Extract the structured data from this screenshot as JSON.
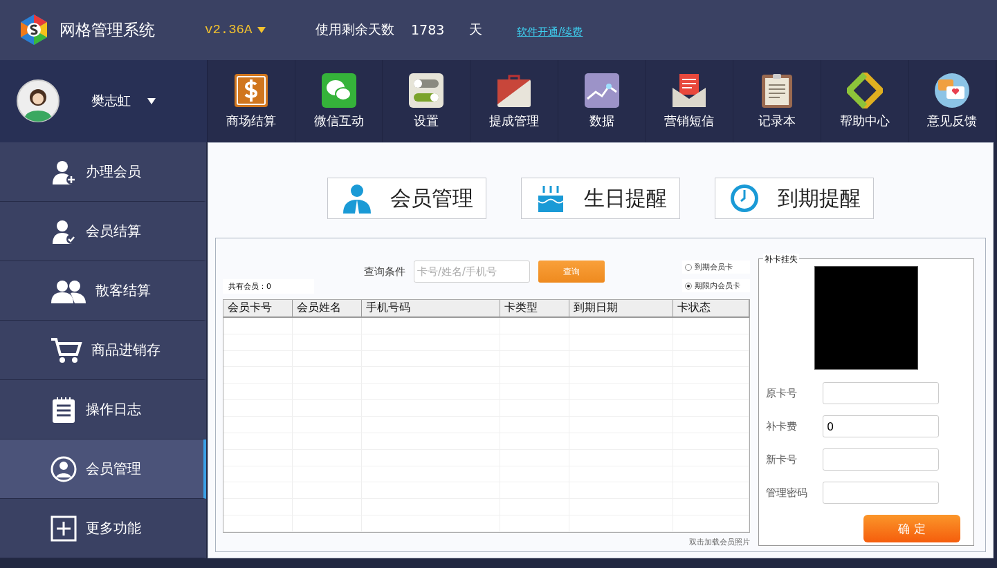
{
  "header": {
    "app_title": "网格管理系统",
    "version": "v2.36A",
    "days_label": "使用剩余天数",
    "days_value": "1783",
    "days_unit": "天",
    "renew_link": "软件开通/续费"
  },
  "user": {
    "name": "樊志虹"
  },
  "toolbar": [
    {
      "label": "商场结算"
    },
    {
      "label": "微信互动"
    },
    {
      "label": "设置"
    },
    {
      "label": "提成管理"
    },
    {
      "label": "数据"
    },
    {
      "label": "营销短信"
    },
    {
      "label": "记录本"
    },
    {
      "label": "帮助中心"
    },
    {
      "label": "意见反馈"
    }
  ],
  "sidebar": {
    "items": [
      {
        "label": "办理会员",
        "selected": false
      },
      {
        "label": "会员结算",
        "selected": false
      },
      {
        "label": "散客结算",
        "selected": false
      },
      {
        "label": "商品进销存",
        "selected": false
      },
      {
        "label": "操作日志",
        "selected": false
      },
      {
        "label": "会员管理",
        "selected": true
      },
      {
        "label": "更多功能",
        "selected": false
      }
    ]
  },
  "tabs": [
    {
      "label": "会员管理"
    },
    {
      "label": "生日提醒"
    },
    {
      "label": "到期提醒"
    }
  ],
  "member_panel": {
    "total_label": "共有会员：0",
    "query_label": "查询条件",
    "search_placeholder": "卡号/姓名/手机号",
    "search_button": "查询",
    "filters": [
      {
        "label": "到期会员卡",
        "selected": false
      },
      {
        "label": "期限内会员卡",
        "selected": true
      }
    ],
    "table": {
      "columns": [
        "会员卡号",
        "会员姓名",
        "手机号码",
        "卡类型",
        "到期日期",
        "卡状态"
      ]
    },
    "photo_hint": "双击加载会员照片"
  },
  "reissue": {
    "title": "补卡挂失",
    "fields": [
      {
        "label": "原卡号"
      },
      {
        "label": "补卡费",
        "value": "0"
      },
      {
        "label": "新卡号"
      },
      {
        "label": "管理密码"
      }
    ],
    "confirm": "确 定"
  }
}
